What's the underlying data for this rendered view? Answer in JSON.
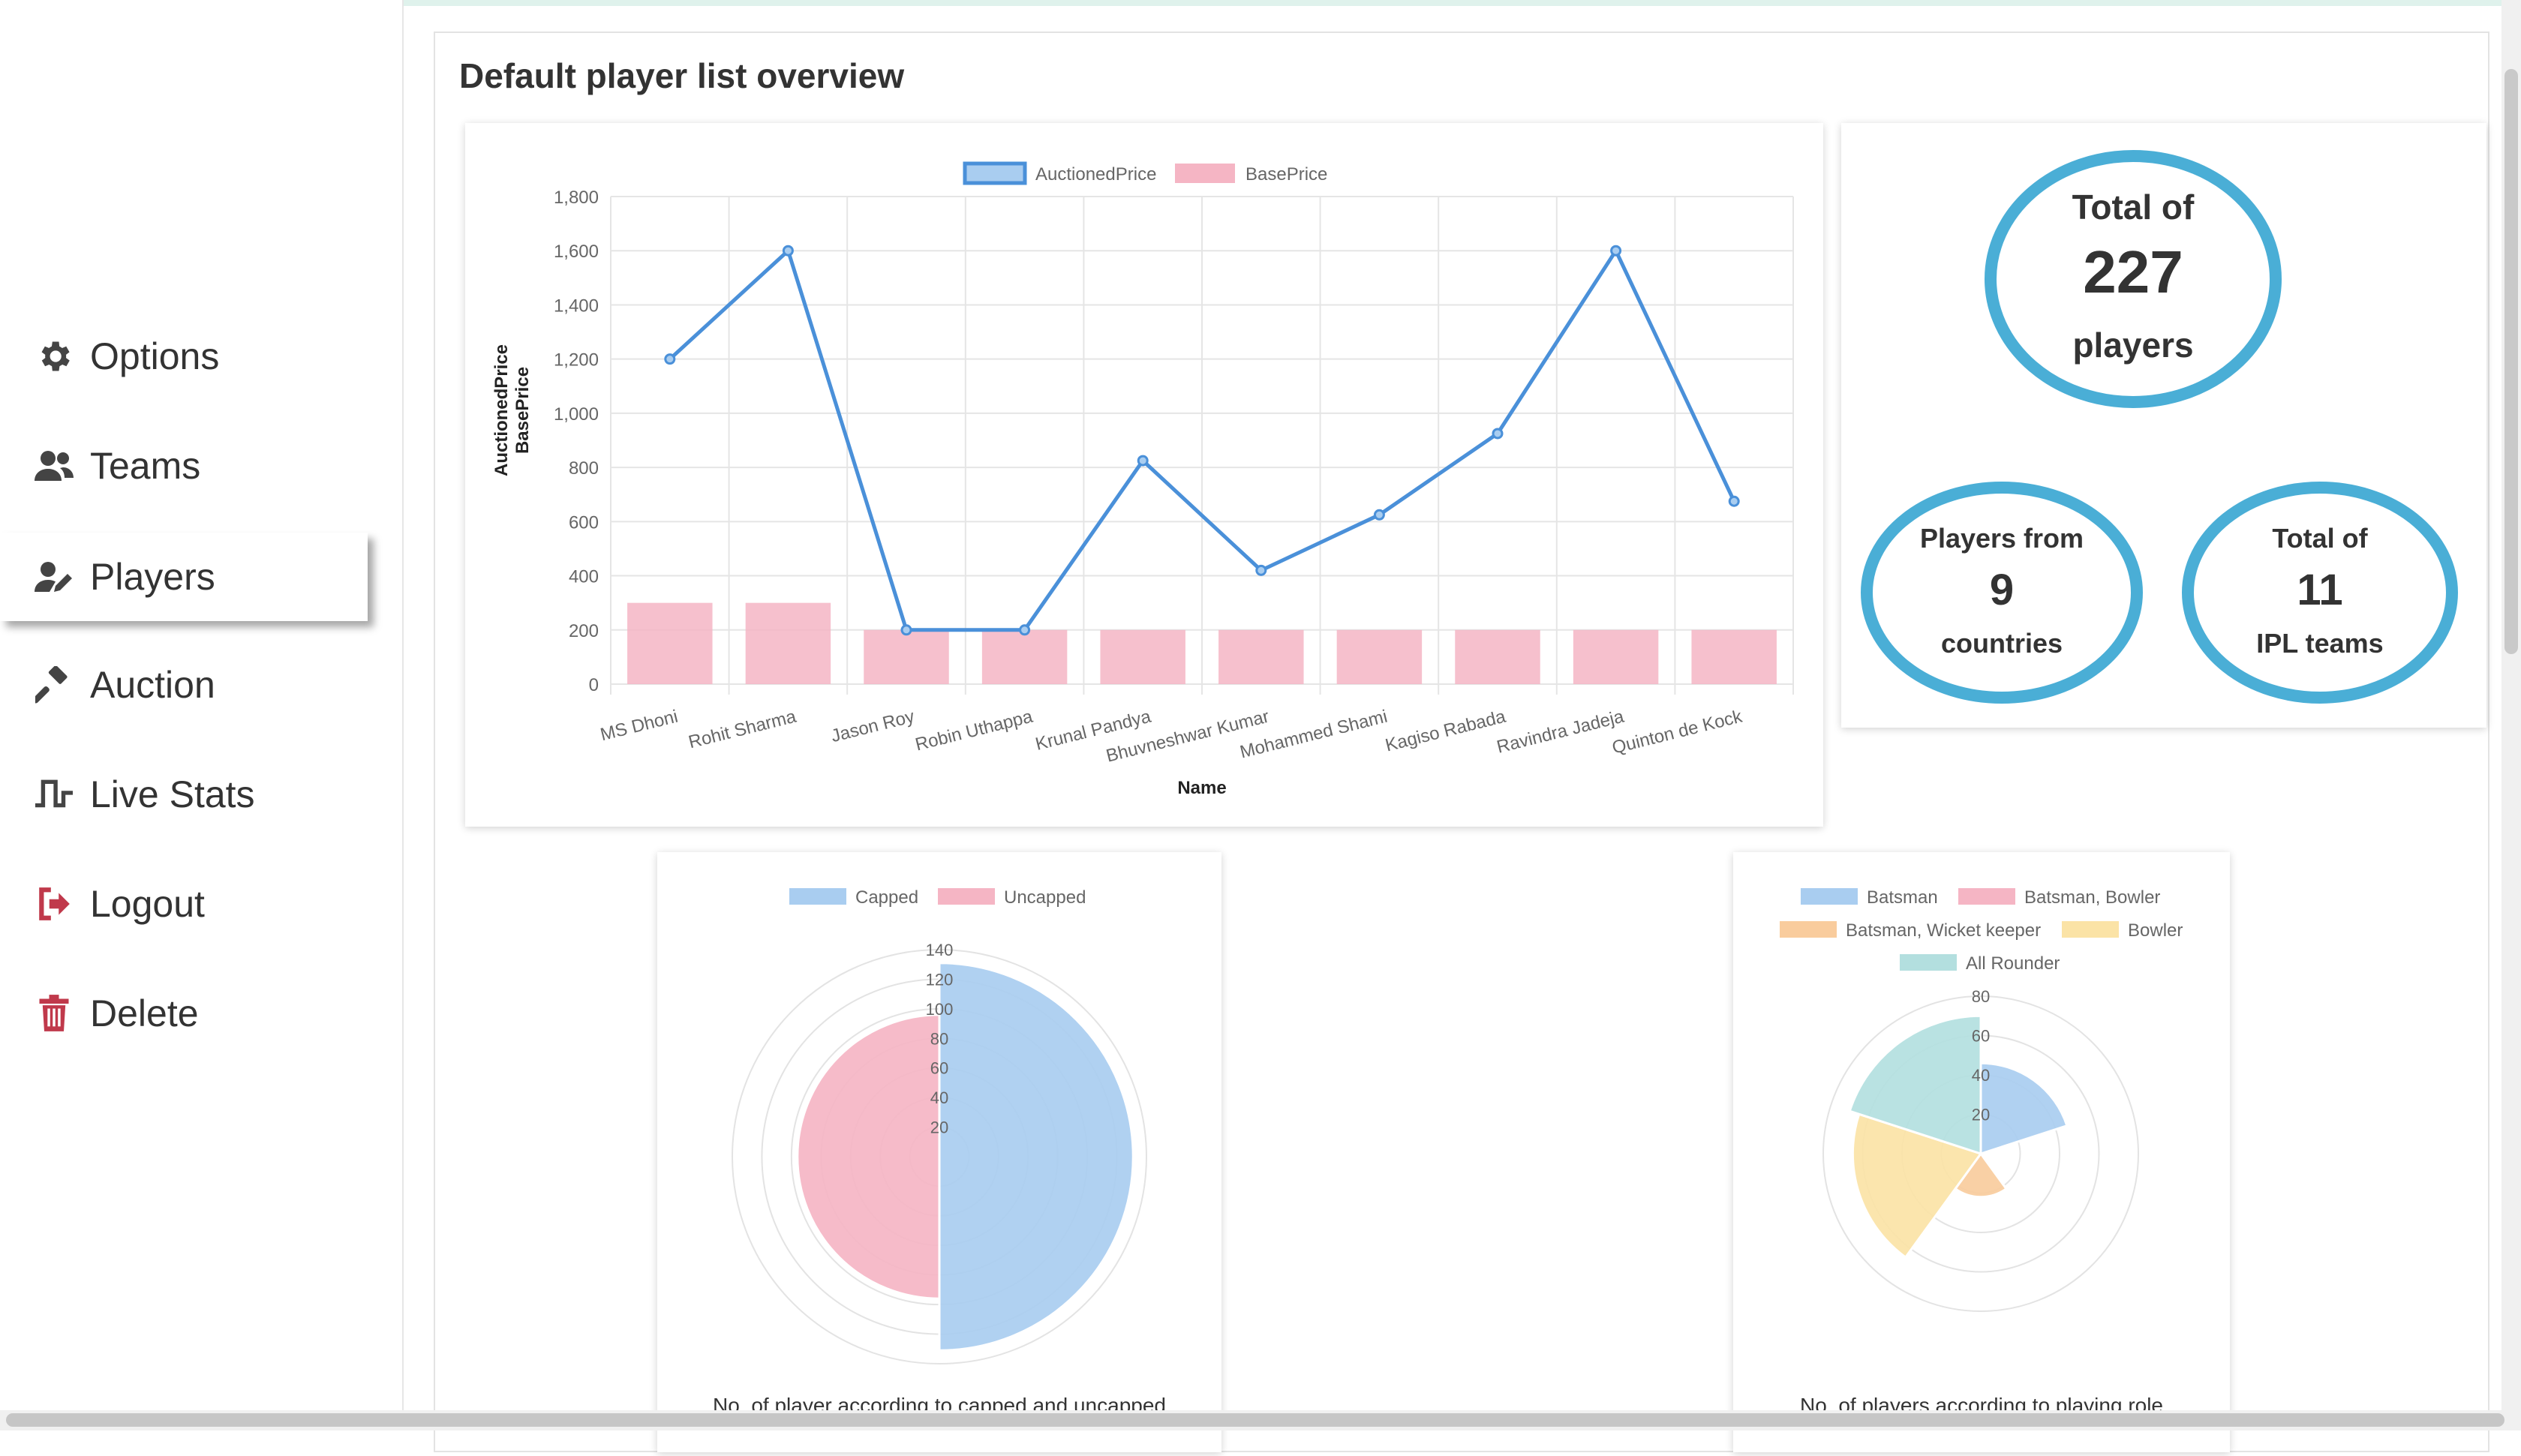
{
  "sidebar": {
    "items": [
      {
        "label": "Options",
        "icon": "gear-icon",
        "color": "#444444"
      },
      {
        "label": "Teams",
        "icon": "users-icon",
        "color": "#444444"
      },
      {
        "label": "Players",
        "icon": "user-edit-icon",
        "color": "#444444",
        "active": true
      },
      {
        "label": "Auction",
        "icon": "gavel-icon",
        "color": "#444444"
      },
      {
        "label": "Live Stats",
        "icon": "pulse-icon",
        "color": "#444444"
      },
      {
        "label": "Logout",
        "icon": "logout-icon",
        "color": "#c0394b"
      },
      {
        "label": "Delete",
        "icon": "trash-icon",
        "color": "#c0394b"
      }
    ]
  },
  "main": {
    "title": "Default player list overview"
  },
  "stats": {
    "players": {
      "top": "Total of",
      "value": "227",
      "bottom": "players"
    },
    "countries": {
      "top": "Players from",
      "value": "9",
      "bottom": "countries"
    },
    "teams": {
      "top": "Total of",
      "value": "11",
      "bottom": "IPL teams"
    },
    "ring_color": "#4aaed6"
  },
  "captions": {
    "polar1": "No. of player according to capped and uncapped",
    "polar2": "No. of players according to playing role"
  },
  "chart_data": [
    {
      "type": "bar",
      "categories": [
        "MS Dhoni",
        "Rohit Sharma",
        "Jason Roy",
        "Robin Uthappa",
        "Krunal Pandya",
        "Bhuvneshwar Kumar",
        "Mohammed Shami",
        "Kagiso Rabada",
        "Ravindra Jadeja",
        "Quinton de Kock"
      ],
      "series": [
        {
          "name": "AuctionedPrice",
          "kind": "line",
          "color": "#4a90d9",
          "values": [
            1200,
            1600,
            200,
            200,
            825,
            420,
            625,
            925,
            1600,
            675
          ]
        },
        {
          "name": "BasePrice",
          "kind": "bar",
          "color": "#f5b5c4",
          "values": [
            300,
            300,
            200,
            200,
            200,
            200,
            200,
            200,
            200,
            200
          ]
        }
      ],
      "xlabel": "Name",
      "ylabel": [
        "AuctionedPrice",
        "BasePrice"
      ],
      "ylim": [
        0,
        1800
      ],
      "yticks": [
        "0",
        "200",
        "400",
        "600",
        "800",
        "1,000",
        "1,200",
        "1,400",
        "1,600",
        "1,800"
      ],
      "legend": "top",
      "grid": true
    },
    {
      "type": "polarArea",
      "labels": [
        "Capped",
        "Uncapped"
      ],
      "values": [
        131,
        96
      ],
      "colors": [
        "#a9cdf0",
        "#f5b5c4"
      ],
      "rlim": [
        0,
        140
      ],
      "rticks": [
        "20",
        "40",
        "60",
        "80",
        "100",
        "120",
        "140"
      ],
      "legend": "top"
    },
    {
      "type": "polarArea",
      "labels": [
        "Batsman",
        "Batsman, Bowler",
        "Batsman, Wicket keeper",
        "Bowler",
        "All Rounder"
      ],
      "values": [
        46,
        0,
        22,
        65,
        70
      ],
      "colors": [
        "#a9cdf0",
        "#f5b5c4",
        "#f9cc9d",
        "#fbe3a6",
        "#b3dfdf"
      ],
      "rlim": [
        0,
        80
      ],
      "rticks": [
        "20",
        "40",
        "60",
        "80"
      ],
      "legend": "top"
    }
  ]
}
